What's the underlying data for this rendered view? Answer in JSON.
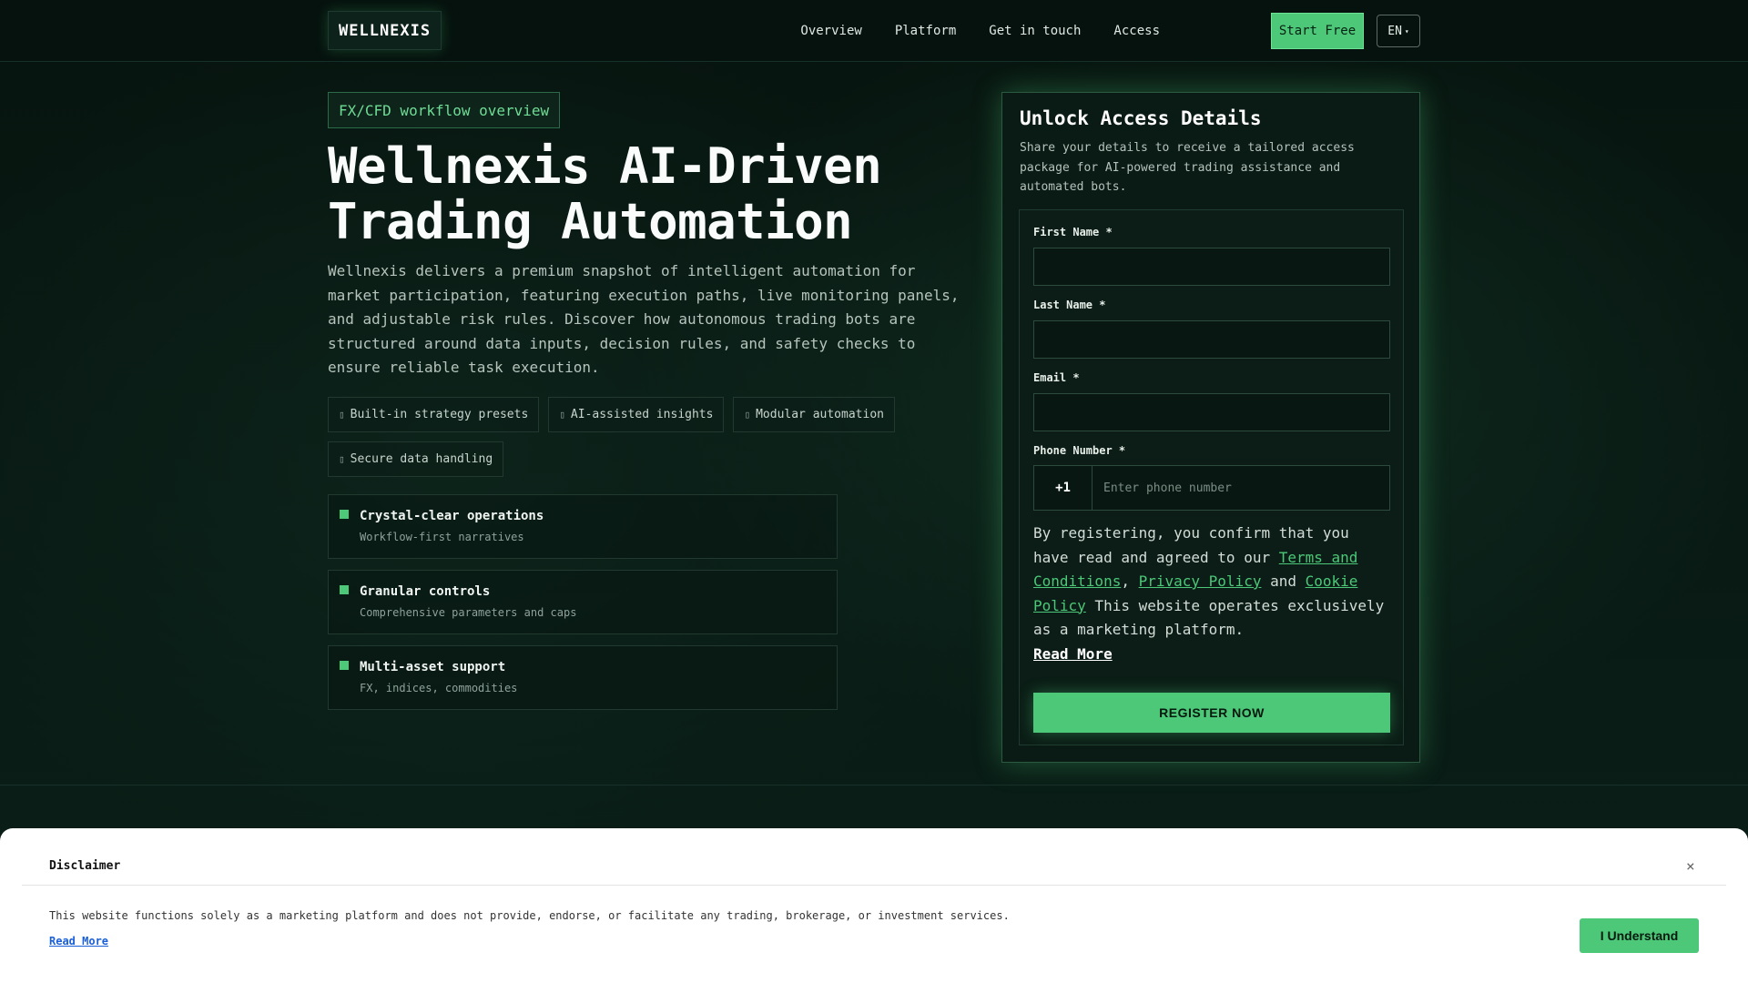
{
  "brand": {
    "logo": "WELLNEXIS",
    "accent": "#4cc878"
  },
  "nav": {
    "items": [
      "Overview",
      "Platform",
      "Get in touch",
      "Access"
    ],
    "start_label": "Start Free",
    "language": "EN"
  },
  "hero": {
    "badge": "FX/CFD workflow overview",
    "title_line1": "Wellnexis AI-Driven",
    "title_line2": "Trading Automation",
    "description": "Wellnexis delivers a premium snapshot of intelligent automation for market participation, featuring execution paths, live monitoring panels, and adjustable risk rules. Discover how autonomous trading bots are structured around data inputs, decision rules, and safety checks to ensure reliable task execution.",
    "chips": [
      "Built-in strategy presets",
      "AI-assisted insights",
      "Modular automation",
      "Secure data handling"
    ],
    "features": [
      {
        "title": "Crystal-clear operations",
        "subtitle": "Workflow-first narratives"
      },
      {
        "title": "Granular controls",
        "subtitle": "Comprehensive parameters and caps"
      },
      {
        "title": "Multi-asset support",
        "subtitle": "FX, indices, commodities"
      }
    ]
  },
  "form": {
    "title": "Unlock Access Details",
    "subtitle": "Share your details to receive a tailored access package for AI-powered trading assistance and automated bots.",
    "first_name_label": "First Name *",
    "last_name_label": "Last Name *",
    "email_label": "Email *",
    "phone_label": "Phone Number *",
    "phone_code": "+1",
    "phone_placeholder": "Enter phone number",
    "consent_prefix": "By registering, you confirm that you have read and agreed to our ",
    "terms_link": "Terms and Conditions",
    "comma": ", ",
    "privacy_link": "Privacy Policy",
    "and": " and ",
    "cookie_link": "Cookie Policy",
    "consent_suffix": " This website operates exclusively as a marketing platform.",
    "read_more": "Read More",
    "submit_label": "REGISTER NOW"
  },
  "disclaimer": {
    "title": "Disclaimer",
    "close": "×",
    "text": "This website functions solely as a marketing platform and does not provide, endorse, or facilitate any trading, brokerage, or investment services.",
    "read_more": "Read More",
    "button": "I Understand"
  }
}
